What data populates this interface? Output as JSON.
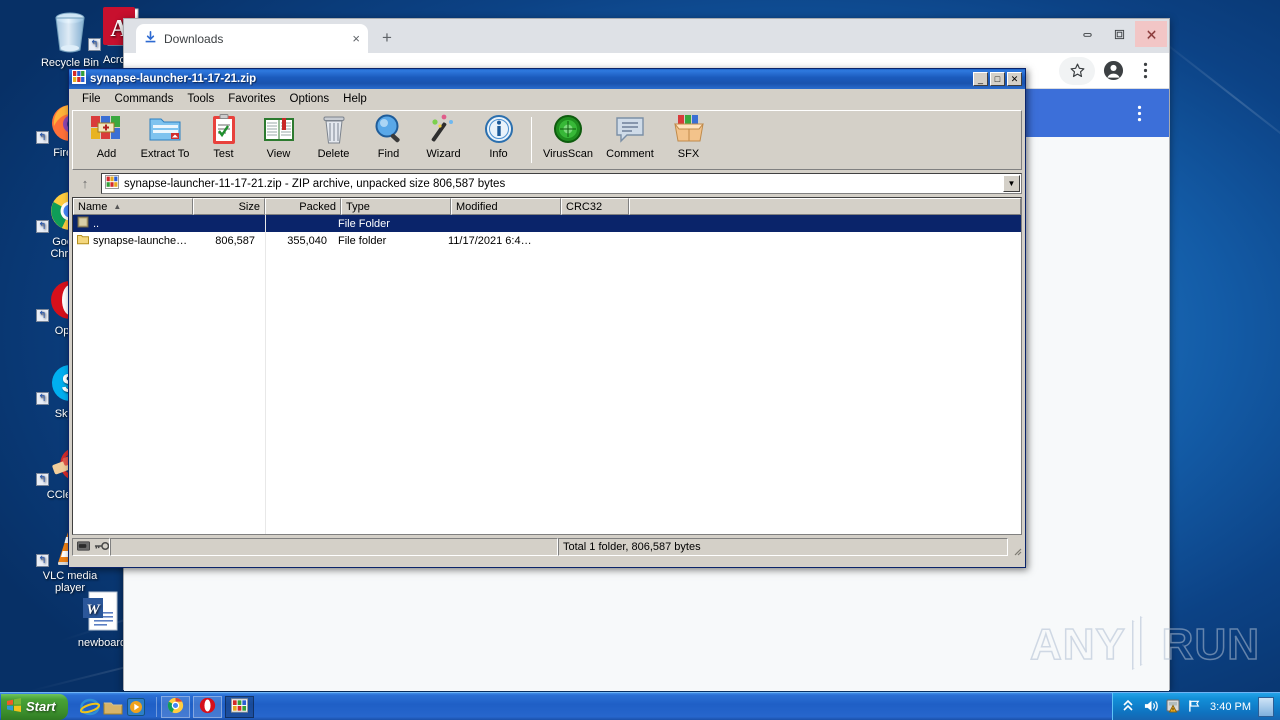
{
  "desktop": {
    "icons": [
      {
        "name": "recycle-bin",
        "label": "Recycle Bin",
        "shortcut": false
      },
      {
        "name": "acrobat",
        "label": "Acrobat",
        "shortcut": true
      },
      {
        "name": "firefox",
        "label": "Firefox",
        "shortcut": true
      },
      {
        "name": "google-chrome",
        "label": "Google\nChrome",
        "shortcut": true
      },
      {
        "name": "opera",
        "label": "Opera",
        "shortcut": true
      },
      {
        "name": "skype",
        "label": "Skype",
        "shortcut": true
      },
      {
        "name": "ccleaner",
        "label": "CCleaner",
        "shortcut": true
      },
      {
        "name": "vlc",
        "label": "VLC media\nplayer",
        "shortcut": true
      },
      {
        "name": "newboard",
        "label": "newboard",
        "shortcut": false
      }
    ],
    "watermark": {
      "left_text": "ANY",
      "right_text": "RUN"
    }
  },
  "chrome": {
    "tab": {
      "title": "Downloads",
      "icon": "download-icon",
      "close_label": "×"
    },
    "new_tab_label": "+",
    "window_controls": {
      "minimize": "—",
      "maximize": "❐",
      "close": "✕"
    },
    "toolbar": {
      "bookmark_icon": "star-icon",
      "profile_icon": "account-icon",
      "menu_icon": "kebab-menu-icon"
    },
    "download_row": {
      "menu_icon": "kebab-menu-icon",
      "accent_color": "#3c6fd9"
    }
  },
  "winrar": {
    "title": "synapse-launcher-11-17-21.zip",
    "title_icon": "winrar-books-icon",
    "window_controls": {
      "minimize": "_",
      "maximize": "□",
      "close": "✕"
    },
    "menu": [
      "File",
      "Commands",
      "Tools",
      "Favorites",
      "Options",
      "Help"
    ],
    "toolbar": [
      {
        "label": "Add",
        "icon": "add-archive-icon"
      },
      {
        "label": "Extract To",
        "icon": "extract-folder-icon"
      },
      {
        "label": "Test",
        "icon": "clipboard-check-icon"
      },
      {
        "label": "View",
        "icon": "open-book-icon"
      },
      {
        "label": "Delete",
        "icon": "trash-can-icon"
      },
      {
        "label": "Find",
        "icon": "magnifier-icon"
      },
      {
        "label": "Wizard",
        "icon": "magic-wand-icon"
      },
      {
        "label": "Info",
        "icon": "info-circle-icon"
      },
      {
        "label": "VirusScan",
        "icon": "virus-shield-icon"
      },
      {
        "label": "Comment",
        "icon": "comment-bubble-icon"
      },
      {
        "label": "SFX",
        "icon": "sfx-box-icon"
      }
    ],
    "address": {
      "up_icon": "up-arrow-icon",
      "text": "synapse-launcher-11-17-21.zip - ZIP archive, unpacked size 806,587 bytes",
      "dropdown_icon": "chevron-down-icon"
    },
    "columns": [
      {
        "key": "name",
        "label": "Name",
        "sort": "▲"
      },
      {
        "key": "size",
        "label": "Size"
      },
      {
        "key": "packed",
        "label": "Packed"
      },
      {
        "key": "type",
        "label": "Type"
      },
      {
        "key": "mod",
        "label": "Modified"
      },
      {
        "key": "crc",
        "label": "CRC32"
      }
    ],
    "rows": [
      {
        "name": "..",
        "size": "",
        "packed": "",
        "type": "File Folder",
        "mod": "",
        "crc": "",
        "selected": true,
        "icon": "parent-folder-icon"
      },
      {
        "name": "synapse-launche…",
        "size": "806,587",
        "packed": "355,040",
        "type": "File folder",
        "mod": "11/17/2021 6:4…",
        "crc": "",
        "selected": false,
        "icon": "folder-icon"
      }
    ],
    "status": {
      "left_icons": [
        "drive-icon",
        "key-icon"
      ],
      "middle": "",
      "right": "Total 1 folder, 806,587 bytes"
    }
  },
  "taskbar": {
    "start_label": "Start",
    "quick_launch": [
      {
        "name": "internet-explorer-icon"
      },
      {
        "name": "show-desktop-icon"
      },
      {
        "name": "windows-media-player-icon"
      }
    ],
    "tasks": [
      {
        "name": "chrome-task",
        "icon": "chrome-icon",
        "active": false
      },
      {
        "name": "opera-task",
        "icon": "opera-icon",
        "active": false
      },
      {
        "name": "winrar-task",
        "icon": "winrar-icon",
        "active": true
      }
    ],
    "tray": {
      "icons": [
        "show-hidden-icons",
        "volume-icon",
        "security-shield-icon",
        "network-icon"
      ],
      "clock": "3:40 PM"
    }
  }
}
